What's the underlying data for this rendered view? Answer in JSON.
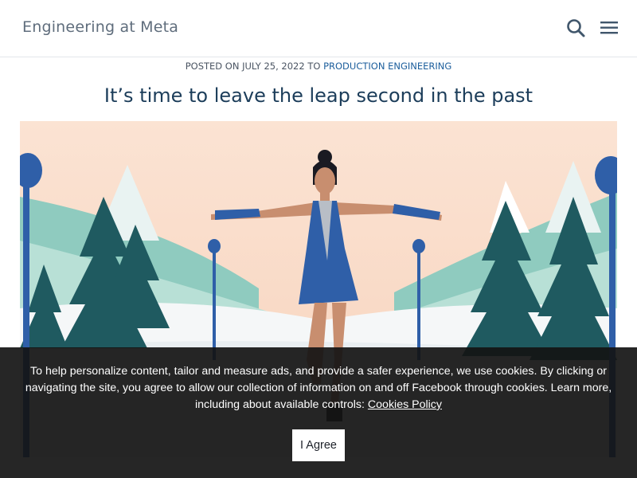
{
  "header": {
    "logo_text": "Engineering at Meta",
    "search_icon": "search-icon",
    "menu_icon": "hamburger-menu-icon"
  },
  "post": {
    "meta_prefix": "POSTED ON JULY 25, 2022 TO ",
    "category_link": "PRODUCTION ENGINEERING",
    "title": "It’s time to leave the leap second in the past",
    "hero_image": "illustration-figure-skater-winter-scene"
  },
  "cookie_banner": {
    "text": "To help personalize content, tailor and measure ads, and provide a safer experience, we use cookies. By clicking or navigating the site, you agree to allow our collection of information on and off Facebook through cookies. Learn more, including about available controls: ",
    "link_label": "Cookies Policy",
    "button_label": "I Agree"
  },
  "colors": {
    "title": "#1c3d5a",
    "link": "#1c5e9c",
    "logo": "#5f6d7c",
    "banner_bg": "#141414"
  }
}
